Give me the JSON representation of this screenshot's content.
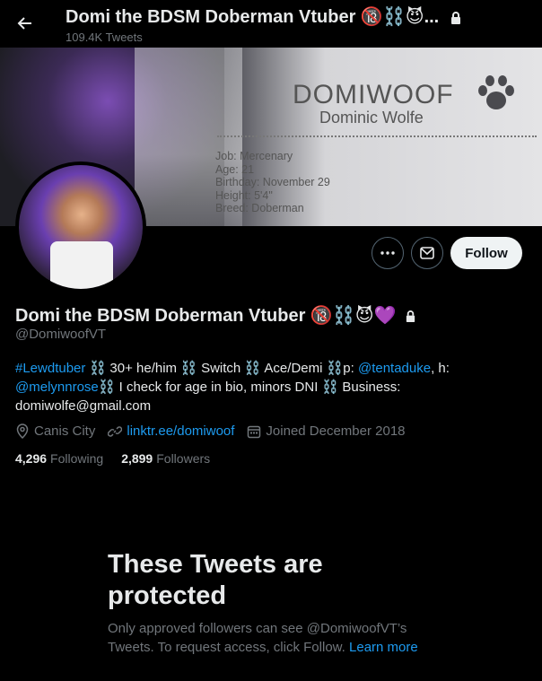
{
  "header": {
    "display_name": "Domi the BDSM Doberman Vtuber 🔞⛓️😈...",
    "tweet_count": "109.4K Tweets"
  },
  "banner": {
    "title": "DOMIWOOF",
    "subtitle": "Dominic Wolfe",
    "info": [
      "Job: Mercenary",
      "Age: 21",
      "Birthday: November 29",
      "Height: 5'4\"",
      "Breed: Doberman"
    ]
  },
  "actions": {
    "follow_label": "Follow"
  },
  "profile": {
    "name": "Domi the BDSM Doberman Vtuber 🔞⛓️😈💜",
    "handle": "@DomiwoofVT",
    "bio_parts": {
      "hashtag": "#Lewdtuber",
      "t1": " ⛓️ 30+ he/him ⛓️ Switch ⛓️ Ace/Demi ⛓️p: ",
      "mention1": "@tentaduke",
      "t2": ", h: ",
      "mention2": "@melynnrose",
      "t3": "⛓️ I check for age in bio, minors DNI ⛓️ Business: domiwolfe@gmail.com"
    },
    "location": "Canis City",
    "website": "linktr.ee/domiwoof",
    "joined": "Joined December 2018",
    "following_count": "4,296",
    "following_label": "Following",
    "followers_count": "2,899",
    "followers_label": "Followers"
  },
  "protected": {
    "title": "These Tweets are protected",
    "desc": "Only approved followers can see @DomiwoofVT’s Tweets. To request access, click Follow.",
    "learn_more": "Learn more"
  },
  "colors": {
    "accent": "#1d9bf0",
    "muted": "#71767b",
    "text": "#e7e9ea"
  },
  "icons": [
    "back-arrow-icon",
    "lock-icon",
    "more-icon",
    "message-icon",
    "location-icon",
    "link-icon",
    "calendar-icon",
    "paw-icon"
  ]
}
